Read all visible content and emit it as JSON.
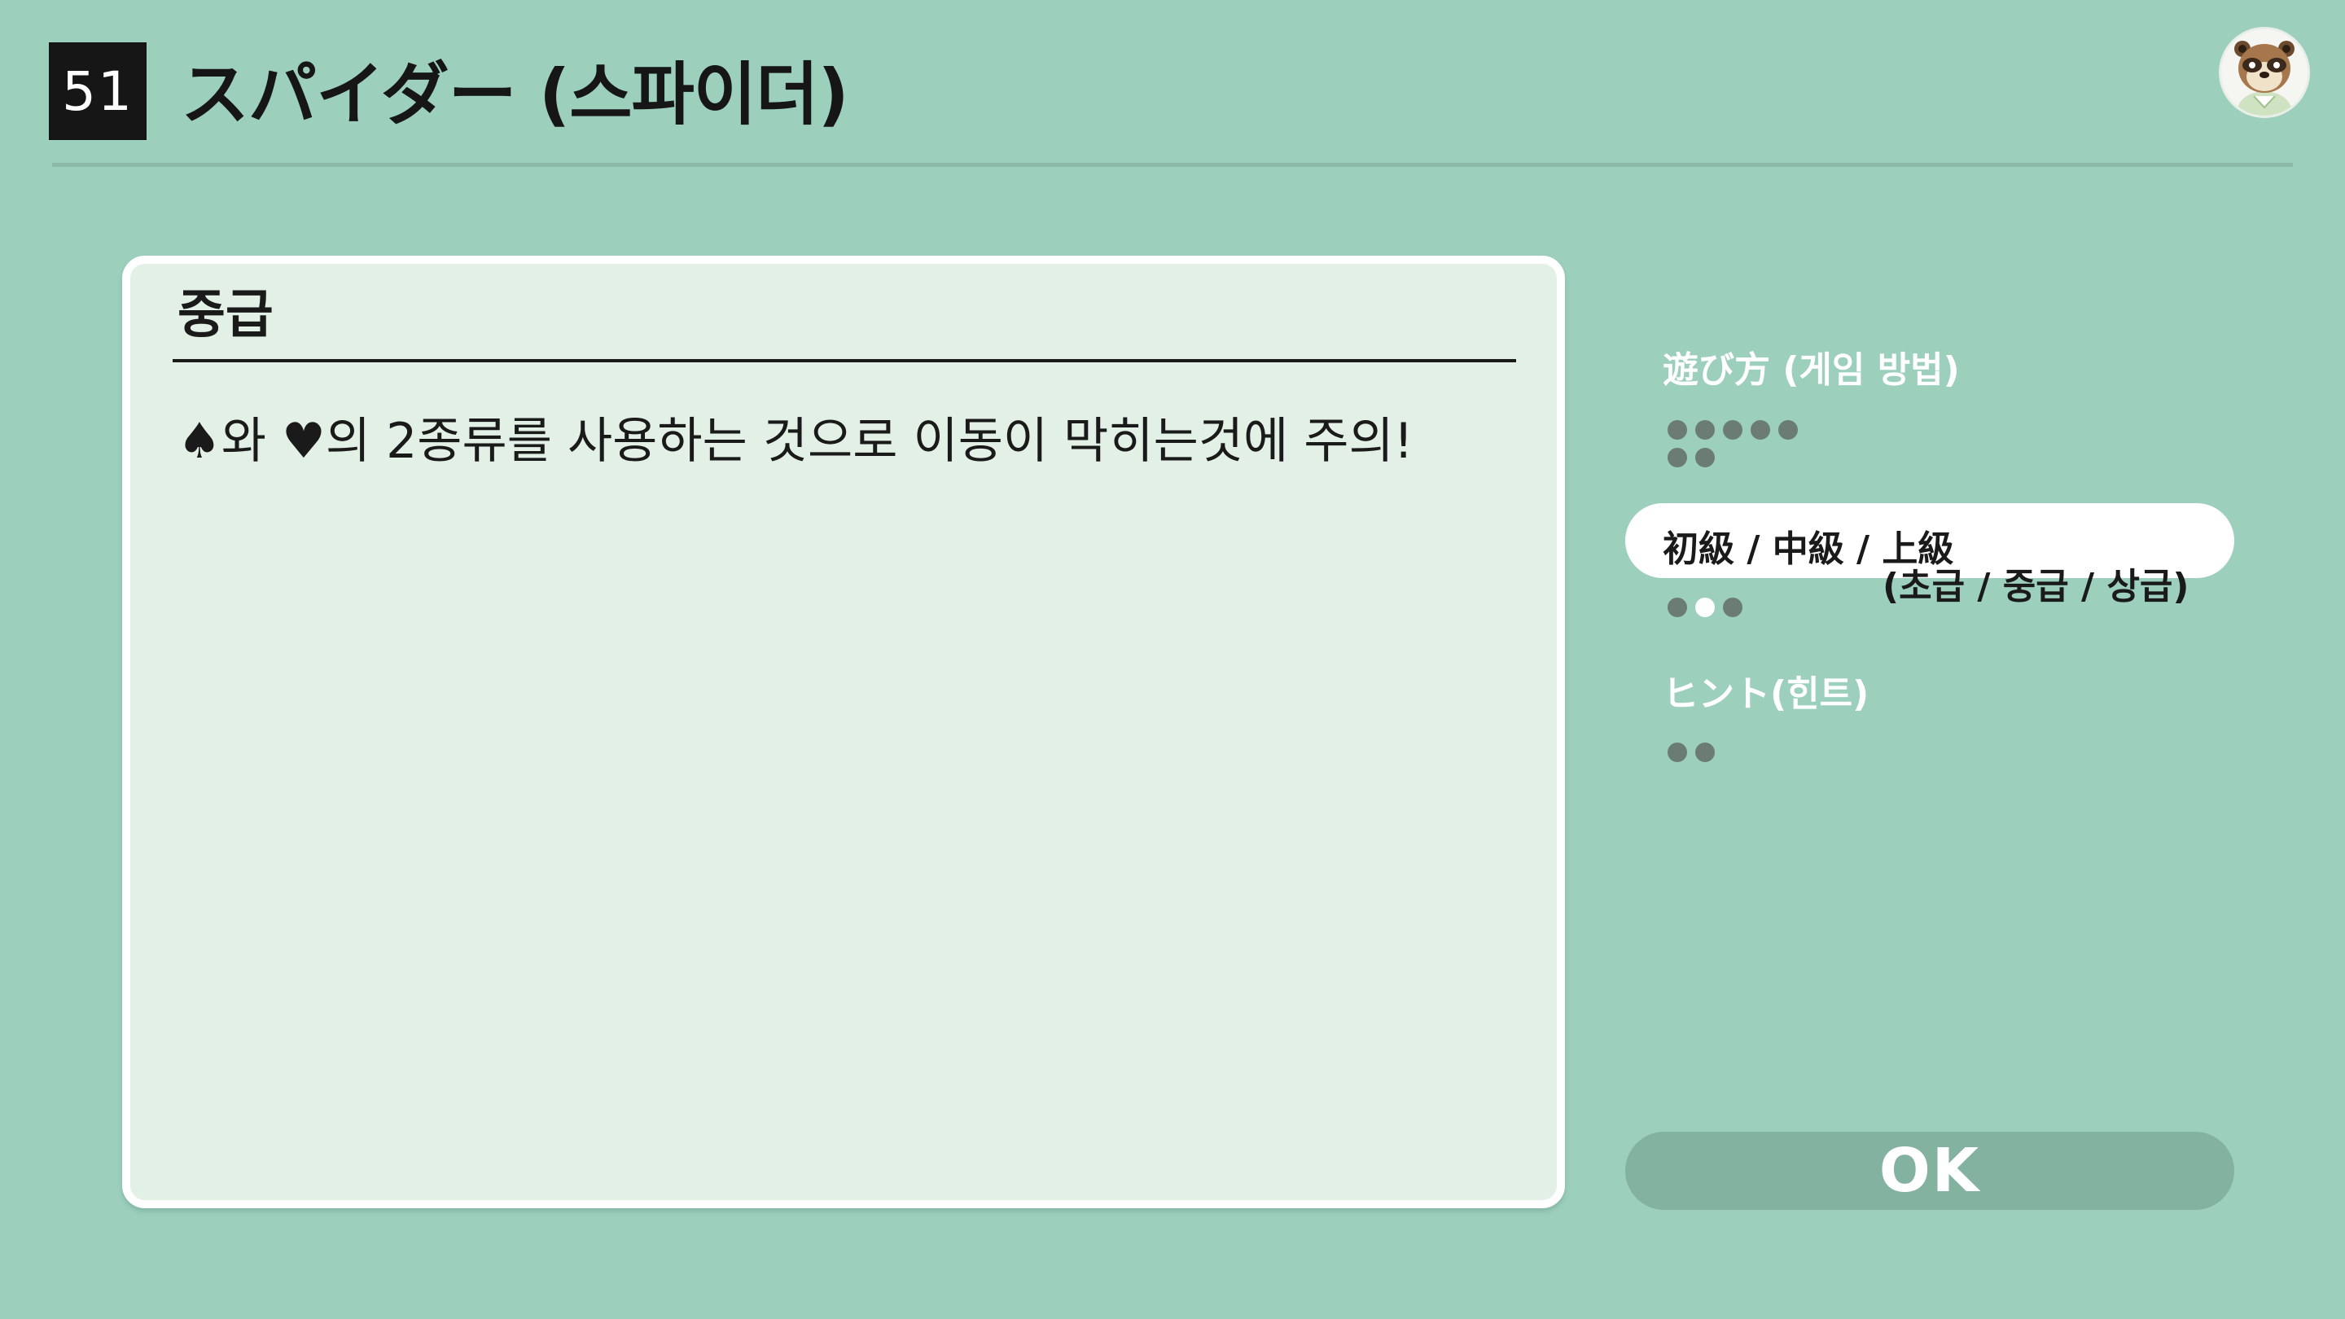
{
  "header": {
    "number": "51",
    "title": "スパイダー (스파이더)"
  },
  "panel": {
    "heading": "중급",
    "text": "♠와 ♥의 2종류를 사용하는 것으로 이동이 막히는것에 주의!"
  },
  "menu": {
    "items": [
      {
        "label": "遊び方 (게임 방법)",
        "sub": "",
        "dots": 7,
        "active": false
      },
      {
        "label": "初級 / 中級 / 上級",
        "sub": "(초급 / 중급 / 상급)",
        "dots": 3,
        "active": true,
        "selected_dot": 2
      },
      {
        "label": "ヒント(힌트)",
        "sub": "",
        "dots": 2,
        "active": false
      }
    ]
  },
  "ok_label": "OK",
  "colors": {
    "background": "#9dcfbd",
    "panel_fill": "#e2f0e5",
    "button_fill": "#84b2a0",
    "dot": "#6b7c75"
  },
  "icons": {
    "avatar": "tom-nook-avatar-icon"
  }
}
